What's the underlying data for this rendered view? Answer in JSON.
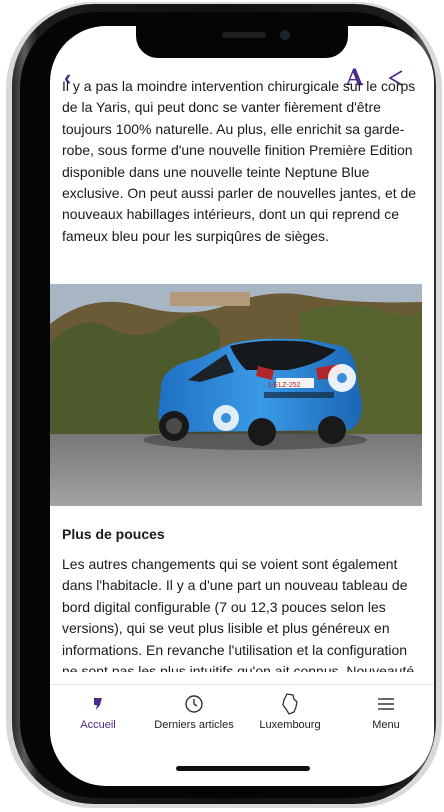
{
  "article": {
    "intro_text": "Il y a pas la moindre intervention chirurgicale sur le corps de la Yaris, qui peut donc se vanter fièrement d'être toujours 100% naturelle. Au plus, elle enrichit sa garde-robe, sous forme d'une nouvelle finition Première Edition disponible dans une nouvelle teinte Neptune Blue exclusive. On peut aussi parler de nouvelles jantes, et de nouveaux habillages intérieurs, dont un qui reprend ce fameux bleu pour les surpiqûres de sièges.",
    "photo": {
      "plate": "1-ELZ-252"
    },
    "section_title": "Plus de pouces",
    "section_text": "Les autres changements qui se voient sont également dans l'habitacle. Il y a d'une part un nouveau tableau de bord digital configurable (7 ou 12,3 pouces selon les versions), qui se veut plus lisible et plus généreux en informations. En revanche l'utilisation et la configuration ne sont pas les plus intuitifs qu'on ait connus. Nouveauté également au"
  },
  "topbar": {
    "back_icon": "chevron-left-icon",
    "font_icon": "A",
    "share_icon": "share-icon"
  },
  "tabs": [
    {
      "label": "Accueil",
      "icon": "home-logo-icon",
      "active": true
    },
    {
      "label": "Derniers articles",
      "icon": "clock-icon",
      "active": false
    },
    {
      "label": "Luxembourg",
      "icon": "luxembourg-map-icon",
      "active": false
    },
    {
      "label": "Menu",
      "icon": "hamburger-menu-icon",
      "active": false
    }
  ],
  "colors": {
    "accent": "#4d2a8a",
    "text": "#1a1a1a"
  }
}
